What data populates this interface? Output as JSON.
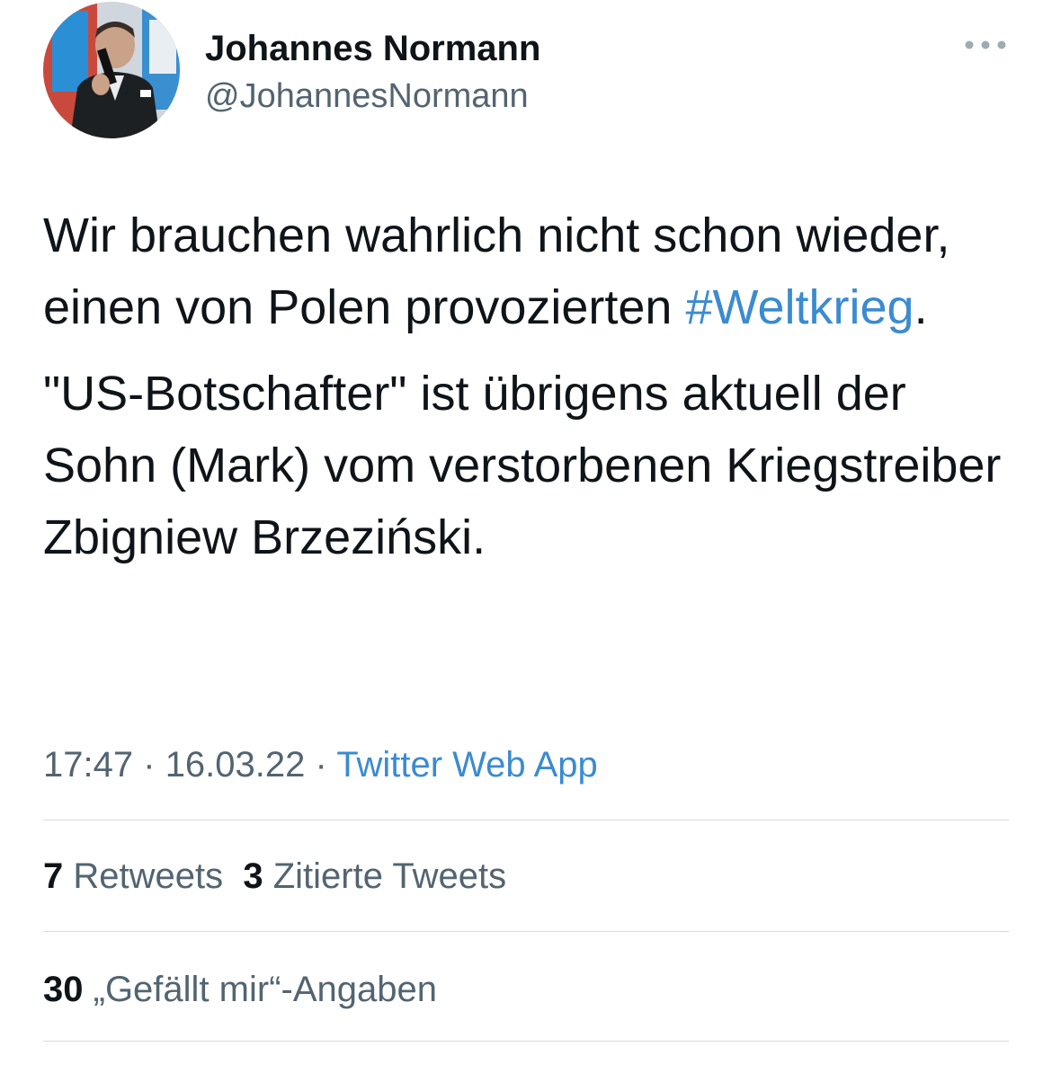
{
  "author": {
    "display_name": "Johannes Normann",
    "handle": "@JohannesNormann",
    "avatar_icon": "profile-photo"
  },
  "more_icon": "more-horizontal-icon",
  "tweet": {
    "paragraph1_text": "Wir brauchen wahrlich nicht schon wieder, einen von Polen provozierten ",
    "hashtag": "#Weltkrieg",
    "paragraph1_end": ".",
    "paragraph2_text": "\"US-Botschafter\" ist übrigens aktuell der Sohn (Mark) vom verstorbenen Kriegstreiber Zbigniew Brzeziński."
  },
  "meta": {
    "time": "17:47",
    "separator": "·",
    "date": "16.03.22",
    "source": "Twitter Web App"
  },
  "stats": {
    "retweets_count": "7",
    "retweets_label": "Retweets",
    "quotes_count": "3",
    "quotes_label": "Zitierte Tweets",
    "likes_count": "30",
    "likes_label": "„Gefällt mir“-Angaben"
  },
  "colors": {
    "link": "#3b8bd0",
    "secondary_text": "#536471",
    "primary_text": "#0f1419",
    "divider": "#d6dadd"
  }
}
